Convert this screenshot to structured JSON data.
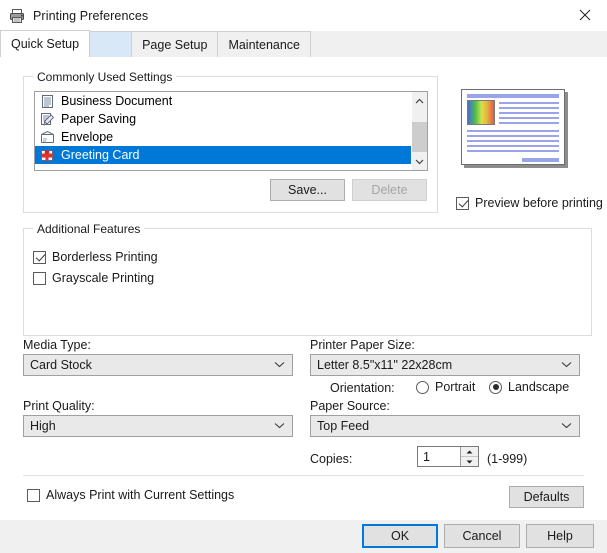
{
  "window": {
    "title": "Printing Preferences",
    "icon": "printer-icon",
    "close_label": "✕"
  },
  "tabs": [
    {
      "label": "Quick Setup",
      "active": true
    },
    {
      "label": "",
      "active": false
    },
    {
      "label": "Page Setup",
      "active": false
    },
    {
      "label": "Maintenance",
      "active": false
    }
  ],
  "commonly_used_settings": {
    "legend": "Commonly Used Settings",
    "items": [
      {
        "label": "Business Document",
        "icon": "document-icon",
        "selected": false
      },
      {
        "label": "Paper Saving",
        "icon": "paper-saving-icon",
        "selected": false
      },
      {
        "label": "Envelope",
        "icon": "envelope-icon",
        "selected": false
      },
      {
        "label": "Greeting Card",
        "icon": "greeting-card-icon",
        "selected": true
      }
    ],
    "save_label": "Save...",
    "delete_label": "Delete",
    "delete_disabled": true,
    "scroll_up": "⌃",
    "scroll_down": "⌄"
  },
  "preview": {
    "checkbox_label": "Preview before printing",
    "checked": true
  },
  "additional_features": {
    "legend": "Additional Features",
    "options": [
      {
        "label": "Borderless Printing",
        "checked": true
      },
      {
        "label": "Grayscale Printing",
        "checked": false
      }
    ]
  },
  "media_type": {
    "label": "Media Type:",
    "value": "Card Stock"
  },
  "print_quality": {
    "label": "Print Quality:",
    "value": "High"
  },
  "printer_paper_size": {
    "label": "Printer Paper Size:",
    "value": "Letter 8.5\"x11\" 22x28cm"
  },
  "orientation": {
    "label": "Orientation:",
    "options": [
      {
        "label": "Portrait",
        "selected": false
      },
      {
        "label": "Landscape",
        "selected": true
      }
    ]
  },
  "paper_source": {
    "label": "Paper Source:",
    "value": "Top Feed"
  },
  "copies": {
    "label": "Copies:",
    "value": "1",
    "range": "(1-999)",
    "up": "▲",
    "down": "▼"
  },
  "always_print": {
    "label": "Always Print with Current Settings",
    "checked": false
  },
  "defaults_button": "Defaults",
  "dialog_buttons": {
    "ok": "OK",
    "cancel": "Cancel",
    "help": "Help"
  },
  "colors": {
    "accent": "#0078d7",
    "selection": "#0078d7",
    "window_bg": "#f0f0f0",
    "pane_bg": "#ffffff",
    "blank_tab": "#d9e8f7"
  },
  "chevron": "⌄"
}
